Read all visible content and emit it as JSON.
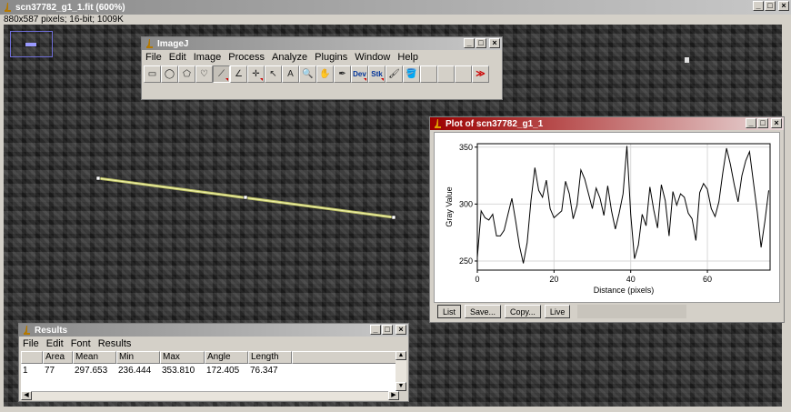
{
  "main": {
    "title": "scn37782_g1_1.fit (600%)",
    "info": "880x587 pixels; 16-bit; 1009K"
  },
  "imagej": {
    "title": "ImageJ",
    "menu": [
      "File",
      "Edit",
      "Image",
      "Process",
      "Analyze",
      "Plugins",
      "Window",
      "Help"
    ],
    "tools": [
      {
        "name": "rectangle-tool-icon",
        "glyph": "▭"
      },
      {
        "name": "oval-tool-icon",
        "glyph": "◯"
      },
      {
        "name": "polygon-tool-icon",
        "glyph": "⬠"
      },
      {
        "name": "freehand-tool-icon",
        "glyph": "♡"
      },
      {
        "name": "line-tool-icon",
        "glyph": "⟋"
      },
      {
        "name": "angle-tool-icon",
        "glyph": "∠"
      },
      {
        "name": "point-tool-icon",
        "glyph": "✛"
      },
      {
        "name": "wand-tool-icon",
        "glyph": "↖"
      },
      {
        "name": "text-tool-icon",
        "glyph": "A"
      },
      {
        "name": "magnifier-tool-icon",
        "glyph": "🔍"
      },
      {
        "name": "hand-tool-icon",
        "glyph": "✋"
      },
      {
        "name": "dropper-tool-icon",
        "glyph": "✒"
      },
      {
        "name": "developer-menu-icon",
        "glyph": "Dev"
      },
      {
        "name": "stack-menu-icon",
        "glyph": "Stk"
      },
      {
        "name": "brush-tool-icon",
        "glyph": "🖌"
      },
      {
        "name": "flood-fill-tool-icon",
        "glyph": "🪣"
      },
      {
        "name": "empty-tool-slot",
        "glyph": ""
      },
      {
        "name": "empty-tool-slot",
        "glyph": ""
      },
      {
        "name": "empty-tool-slot",
        "glyph": ""
      },
      {
        "name": "more-tools-icon",
        "glyph": "≫"
      }
    ]
  },
  "plot": {
    "title": "Plot of scn37782_g1_1",
    "buttons": [
      "List",
      "Save...",
      "Copy...",
      "Live"
    ]
  },
  "results": {
    "title": "Results",
    "menu": [
      "File",
      "Edit",
      "Font",
      "Results"
    ],
    "columns": [
      "",
      "Area",
      "Mean",
      "Min",
      "Max",
      "Angle",
      "Length"
    ],
    "rows": [
      [
        "1",
        "77",
        "297.653",
        "236.444",
        "353.810",
        "172.405",
        "76.347"
      ]
    ]
  },
  "chart_data": {
    "type": "line",
    "title": "",
    "xlabel": "Distance (pixels)",
    "ylabel": "Gray Value",
    "xlim": [
      0,
      76.35
    ],
    "ylim": [
      242,
      353
    ],
    "xticks": [
      0,
      20,
      40,
      60
    ],
    "yticks": [
      250,
      300,
      350
    ],
    "grid": true,
    "x": [
      0,
      1,
      2,
      3,
      4,
      5,
      6,
      7,
      8,
      9,
      10,
      11,
      12,
      13,
      14,
      15,
      16,
      17,
      18,
      19,
      20,
      21,
      22,
      23,
      24,
      25,
      26,
      27,
      28,
      29,
      30,
      31,
      32,
      33,
      34,
      35,
      36,
      37,
      38,
      39,
      40,
      41,
      42,
      43,
      44,
      45,
      46,
      47,
      48,
      49,
      50,
      51,
      52,
      53,
      54,
      55,
      56,
      57,
      58,
      59,
      60,
      61,
      62,
      63,
      64,
      65,
      66,
      67,
      68,
      69,
      70,
      71,
      72,
      73,
      74,
      75,
      76
    ],
    "values": [
      253,
      294,
      288,
      286,
      291,
      272,
      272,
      277,
      291,
      305,
      285,
      263,
      248,
      266,
      303,
      332,
      312,
      306,
      321,
      296,
      288,
      291,
      294,
      320,
      309,
      287,
      299,
      330,
      322,
      309,
      296,
      314,
      305,
      290,
      316,
      294,
      278,
      292,
      309,
      351,
      291,
      252,
      264,
      291,
      281,
      315,
      295,
      279,
      317,
      303,
      272,
      311,
      299,
      309,
      306,
      292,
      287,
      268,
      310,
      318,
      313,
      296,
      289,
      302,
      327,
      349,
      335,
      317,
      302,
      325,
      338,
      346,
      319,
      293,
      262,
      285,
      312
    ]
  }
}
